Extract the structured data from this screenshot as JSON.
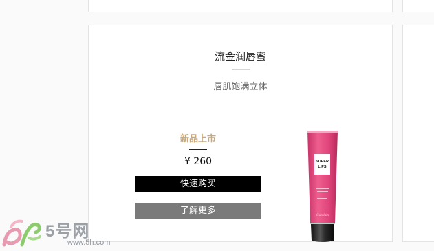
{
  "product": {
    "name": "流金润唇蜜",
    "tagline": "唇肌饱满立体",
    "badge": "新品上市",
    "price": "¥ 260",
    "buy_label": "快速购买",
    "more_label": "了解更多",
    "tube": {
      "label_lines": [
        "SUPER",
        "LIPS"
      ],
      "fine_print": "Guerlain",
      "body_color": "#e0457b",
      "cap_color": "#1a1a1a"
    }
  },
  "watermark": {
    "main": "5号网",
    "url": "www.5h.com"
  },
  "colors": {
    "badge_gold": "#c9a97a",
    "buy_button": "#000000",
    "more_button": "#7a7a7a"
  }
}
